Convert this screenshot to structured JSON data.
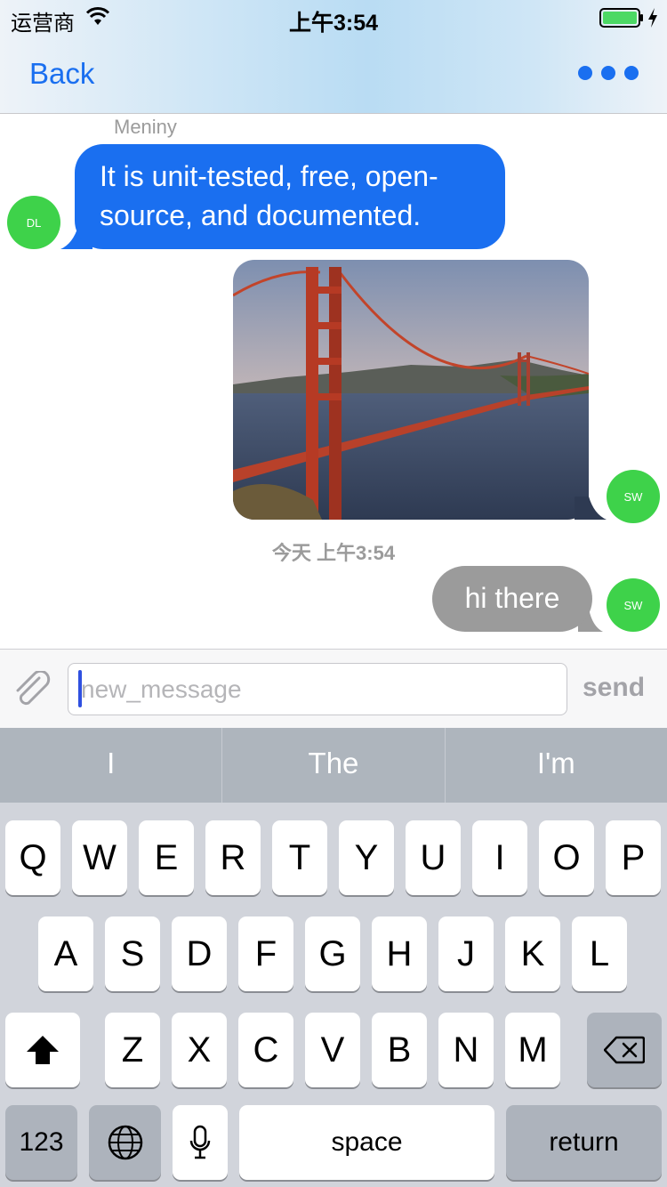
{
  "status_bar": {
    "carrier": "运营商",
    "time": "上午3:54"
  },
  "nav": {
    "back_label": "Back"
  },
  "chat": {
    "messages": [
      {
        "sender_name": "Meniny",
        "text": "It is unit-tested, free, open-source, and documented.",
        "avatar_initials": "DL"
      },
      {
        "type": "photo",
        "avatar_initials": "SW"
      },
      {
        "text": "hi there",
        "avatar_initials": "SW"
      }
    ],
    "timestamp": "今天 上午3:54"
  },
  "input_bar": {
    "placeholder": "new_message",
    "send_label": "send"
  },
  "keyboard": {
    "predictions": [
      "I",
      "The",
      "I'm"
    ],
    "row1": [
      "Q",
      "W",
      "E",
      "R",
      "T",
      "Y",
      "U",
      "I",
      "O",
      "P"
    ],
    "row2": [
      "A",
      "S",
      "D",
      "F",
      "G",
      "H",
      "J",
      "K",
      "L"
    ],
    "row3": [
      "Z",
      "X",
      "C",
      "V",
      "B",
      "N",
      "M"
    ],
    "numbers_label": "123",
    "space_label": "space",
    "return_label": "return"
  },
  "colors": {
    "accent": "#1a6ff0",
    "incoming_bubble": "#1a6ff0",
    "outgoing_bubble": "#9b9b9b",
    "avatar": "#3ed24a",
    "battery": "#4cd964"
  }
}
